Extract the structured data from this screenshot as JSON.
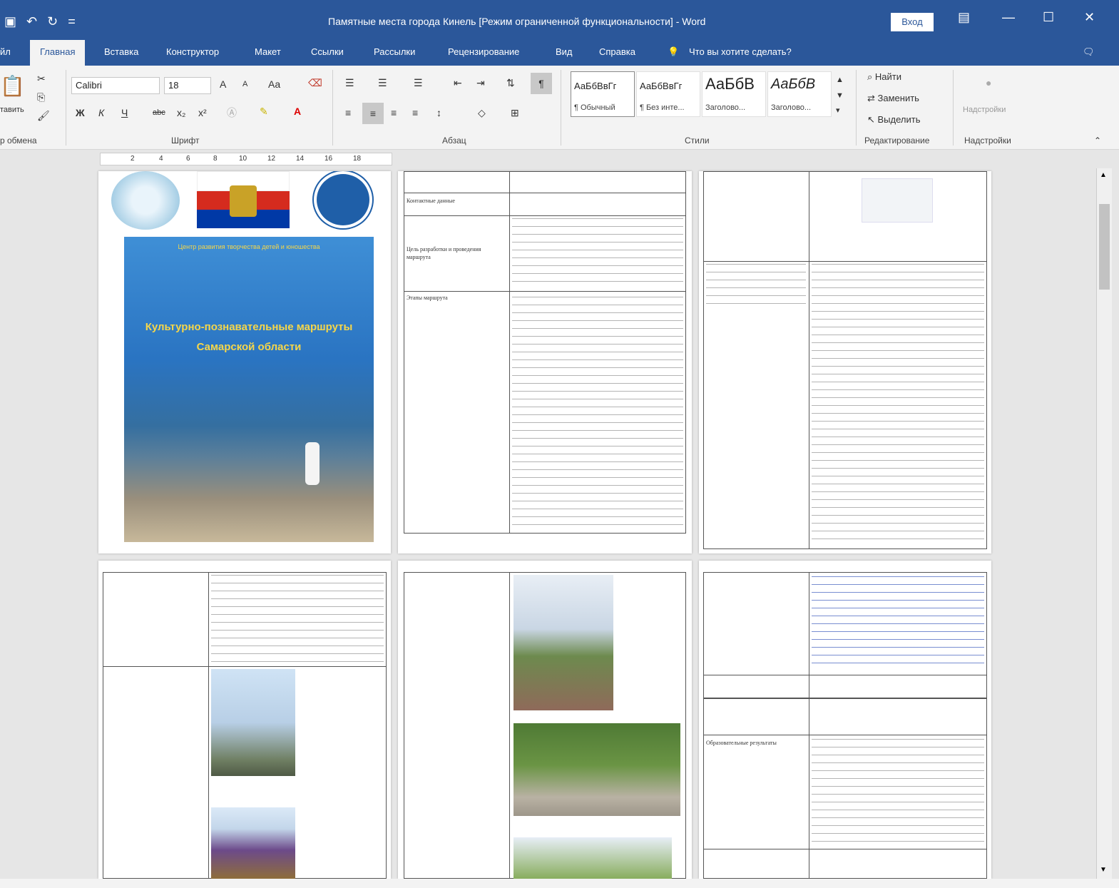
{
  "window": {
    "title": "Памятные места города Кинель [Режим ограниченной функциональности] - Word",
    "signin": "Вход"
  },
  "tabs": [
    "йл",
    "Главная",
    "Вставка",
    "Конструктор",
    "Макет",
    "Ссылки",
    "Рассылки",
    "Рецензирование",
    "Вид",
    "Справка"
  ],
  "tell_me": "Что вы хотите сделать?",
  "ribbon": {
    "clipboard": {
      "paste": "тавить",
      "label": "р обмена"
    },
    "font": {
      "name": "Calibri",
      "size": "18",
      "label": "Шрифт",
      "buttons": [
        "Ж",
        "К",
        "Ч",
        "abc",
        "x₂",
        "x²"
      ],
      "grow": "A",
      "shrink": "A",
      "case": "Aa"
    },
    "paragraph": {
      "label": "Абзац",
      "pilcrow": "¶"
    },
    "styles": {
      "label": "Стили",
      "items": [
        {
          "sample": "АаБбВвГг",
          "name": "¶ Обычный"
        },
        {
          "sample": "АаБбВвГг",
          "name": "¶ Без инте..."
        },
        {
          "sample": "АаБбВ",
          "name": "Заголово..."
        },
        {
          "sample": "АаБбВ",
          "name": "Заголово..."
        }
      ]
    },
    "editing": {
      "find": "Найти",
      "replace": "Заменить",
      "select": "Выделить",
      "label": "Редактирование"
    },
    "addins": {
      "button": "Надстройки",
      "label": "Надстройки"
    }
  },
  "ruler": [
    "2",
    "4",
    "6",
    "8",
    "10",
    "12",
    "14",
    "16",
    "18"
  ],
  "pages": {
    "cover": {
      "title": "Культурно-познавательные маршруты",
      "subtitle": "Самарской области",
      "org": "Центр развития творчества детей и юношества"
    },
    "p2": {
      "rows": [
        "Цель разработки и проведения маршрута",
        "Контактные данные",
        "Этапы маршрута",
        "Образовательные результаты"
      ]
    }
  }
}
